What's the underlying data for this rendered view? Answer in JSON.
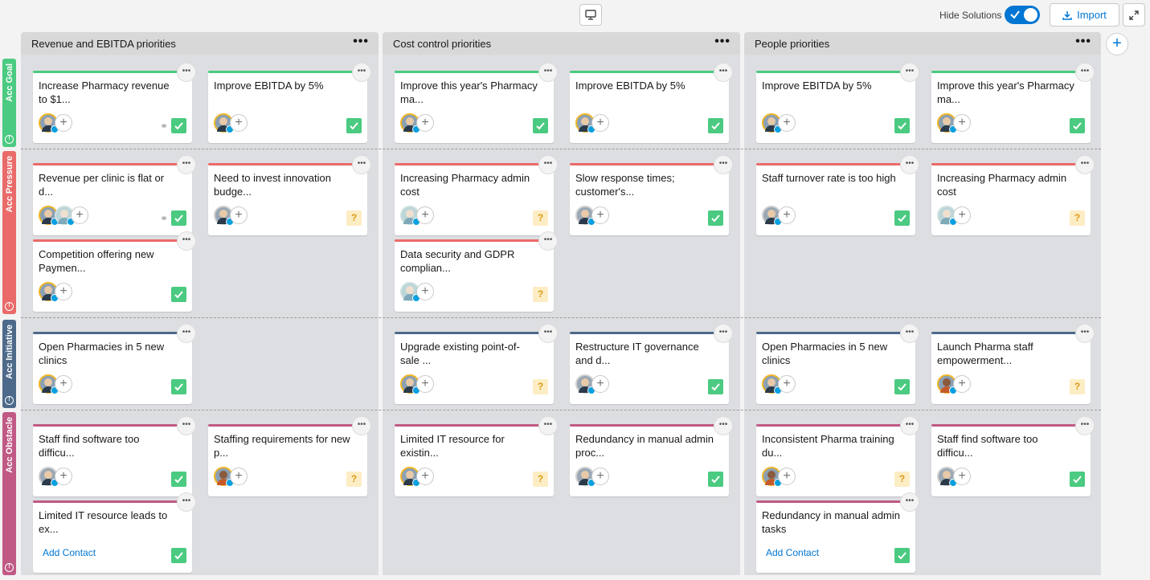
{
  "toolbar": {
    "hide_solutions_label": "Hide Solutions",
    "hide_solutions_on": true,
    "import_label": "Import",
    "add_column_label": "+"
  },
  "colors": {
    "goal": "#4bca81",
    "pressure": "#ea6a6a",
    "initiative": "#4e6a8a",
    "obstacle": "#c05a85",
    "accent": "#0176d3"
  },
  "columns": [
    {
      "title": "Revenue and EBITDA priorities"
    },
    {
      "title": "Cost control priorities"
    },
    {
      "title": "People priorities"
    }
  ],
  "rows": [
    {
      "label": "Acc Goal",
      "key": "goal"
    },
    {
      "label": "Acc Pressure",
      "key": "pressure"
    },
    {
      "label": "Acc Initiative",
      "key": "initiative"
    },
    {
      "label": "Acc Obstacle",
      "key": "obstacle"
    }
  ],
  "cards": [
    {
      "title": "Increase Pharmacy revenue to $1...",
      "status": "done",
      "linked": true
    },
    {
      "title": "Improve EBITDA by 5%",
      "status": "done"
    },
    {
      "title": "Improve this year's Pharmacy ma...",
      "status": "done"
    },
    {
      "title": "Improve EBITDA by 5%",
      "status": "done"
    },
    {
      "title": "Improve EBITDA by 5%",
      "status": "done"
    },
    {
      "title": "Improve this year's Pharmacy ma...",
      "status": "done"
    },
    {
      "title": "Revenue per clinic is flat or d...",
      "status": "done",
      "linked": true
    },
    {
      "title": "Need to invest innovation budge...",
      "status_text": "?"
    },
    {
      "title": "Competition offering new Paymen...",
      "status": "done"
    },
    {
      "title": "Increasing Pharmacy admin cost",
      "status_text": "?"
    },
    {
      "title": "Slow response times; customer's...",
      "status": "done"
    },
    {
      "title": "Data security and GDPR complian...",
      "status_text": "?"
    },
    {
      "title": "Staff turnover rate is too high",
      "status": "done"
    },
    {
      "title": "Increasing Pharmacy admin cost",
      "status_text": "?"
    },
    {
      "title": "Open Pharmacies in 5 new clinics",
      "status": "done"
    },
    {
      "title": "Upgrade existing point-of-sale ...",
      "status_text": "?"
    },
    {
      "title": "Restructure IT governance and d...",
      "status": "done"
    },
    {
      "title": "Open Pharmacies in 5 new clinics",
      "status": "done"
    },
    {
      "title": "Launch Pharma staff empowerment...",
      "status_text": "?"
    },
    {
      "title": "Staff find software too difficu...",
      "status": "done"
    },
    {
      "title": "Staffing requirements for new p...",
      "status_text": "?"
    },
    {
      "title": "Limited IT resource leads to ex...",
      "status": "done",
      "add_contact": "Add Contact"
    },
    {
      "title": "Limited IT resource for existin...",
      "status_text": "?"
    },
    {
      "title": "Redundancy in manual admin proc...",
      "status": "done"
    },
    {
      "title": "Inconsistent Pharma training du...",
      "status_text": "?"
    },
    {
      "title": "Staff find software too difficu...",
      "status": "done"
    },
    {
      "title": "Redundancy in manual admin tasks",
      "status": "done",
      "add_contact": "Add Contact"
    }
  ],
  "add_person_label": "+"
}
